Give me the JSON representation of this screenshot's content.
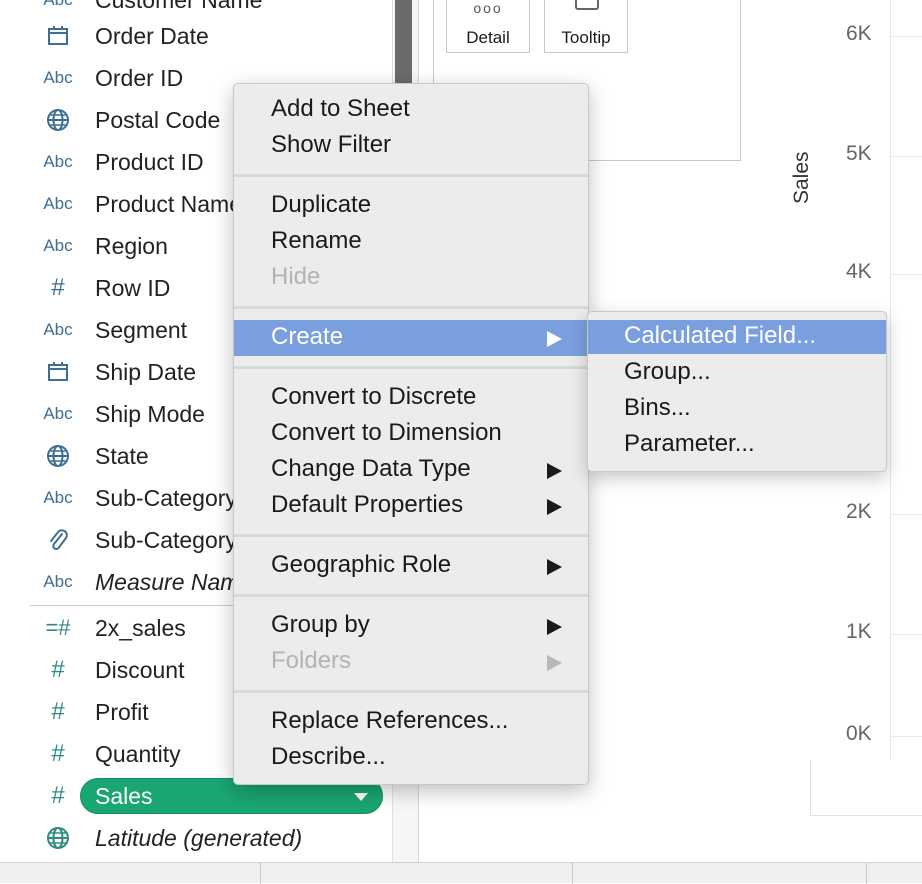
{
  "data_pane": {
    "top_field_partial": {
      "icon": "Abc",
      "label": "Customer Name"
    },
    "dimensions": [
      {
        "icon": "calendar-icon",
        "label": "Order Date"
      },
      {
        "icon": "Abc",
        "label": "Order ID"
      },
      {
        "icon": "globe-icon",
        "label": "Postal Code"
      },
      {
        "icon": "Abc",
        "label": "Product ID"
      },
      {
        "icon": "Abc",
        "label": "Product Name"
      },
      {
        "icon": "Abc",
        "label": "Region"
      },
      {
        "icon": "#",
        "label": "Row ID"
      },
      {
        "icon": "Abc",
        "label": "Segment"
      },
      {
        "icon": "calendar-icon",
        "label": "Ship Date"
      },
      {
        "icon": "Abc",
        "label": "Ship Mode"
      },
      {
        "icon": "globe-icon",
        "label": "State"
      },
      {
        "icon": "Abc",
        "label": "Sub-Category"
      },
      {
        "icon": "paperclip-icon",
        "label": "Sub-Category"
      },
      {
        "icon": "Abc",
        "label": "Measure Names"
      }
    ],
    "measures": [
      {
        "icon": "=#",
        "label": "2x_sales"
      },
      {
        "icon": "#",
        "label": "Discount"
      },
      {
        "icon": "#",
        "label": "Profit"
      },
      {
        "icon": "#",
        "label": "Quantity"
      },
      {
        "icon": "#",
        "label": "Sales"
      },
      {
        "icon": "globe-icon",
        "label": "Latitude (generated)"
      }
    ]
  },
  "marks": {
    "detail_label": "Detail",
    "tooltip_label": "Tooltip",
    "detail_glyph": "ooo"
  },
  "chart": {
    "y_axis_title": "Sales",
    "y_ticks": [
      "6K",
      "5K",
      "4K",
      "2K",
      "1K",
      "0K"
    ]
  },
  "context_menu": {
    "groups": [
      [
        {
          "label": "Add to Sheet"
        },
        {
          "label": "Show Filter"
        }
      ],
      [
        {
          "label": "Duplicate"
        },
        {
          "label": "Rename"
        },
        {
          "label": "Hide",
          "disabled": true
        }
      ],
      [
        {
          "label": "Create",
          "submenu": true,
          "highlighted": true
        }
      ],
      [
        {
          "label": "Convert to Discrete"
        },
        {
          "label": "Convert to Dimension"
        },
        {
          "label": "Change Data Type",
          "submenu": true
        },
        {
          "label": "Default Properties",
          "submenu": true
        }
      ],
      [
        {
          "label": "Geographic Role",
          "submenu": true
        }
      ],
      [
        {
          "label": "Group by",
          "submenu": true
        },
        {
          "label": "Folders",
          "submenu": true,
          "disabled": true
        }
      ],
      [
        {
          "label": "Replace References..."
        },
        {
          "label": "Describe..."
        }
      ]
    ]
  },
  "create_submenu": {
    "items": [
      {
        "label": "Calculated Field...",
        "highlighted": true
      },
      {
        "label": "Group..."
      },
      {
        "label": "Bins..."
      },
      {
        "label": "Parameter..."
      }
    ]
  },
  "colors": {
    "highlight": "#7a9fdf",
    "pill_green": "#1aa673",
    "abc_blue": "#3d6e93",
    "measure_teal": "#2e8b84"
  }
}
